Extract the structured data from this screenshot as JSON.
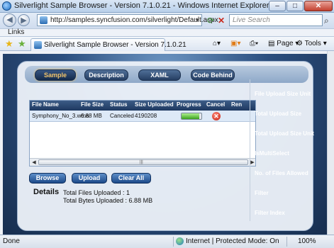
{
  "window": {
    "title": "Silverlight Sample Browser - Version 7.1.0.21 - Windows Internet Explorer",
    "minimize": "–",
    "maximize": "□",
    "close": "✕"
  },
  "address": {
    "url": "http://samples.syncfusion.com/silverlight/Default.aspx",
    "search_placeholder": "Live Search"
  },
  "links": {
    "label": "Links"
  },
  "tab": {
    "label": "Silverlight Sample Browser - Version 7.1.0.21"
  },
  "commands": {
    "page": "Page",
    "tools": "Tools"
  },
  "sample_tabs": [
    {
      "label": "Sample",
      "active": true
    },
    {
      "label": "Description",
      "active": false
    },
    {
      "label": "XAML",
      "active": false
    },
    {
      "label": "Code Behind",
      "active": false
    }
  ],
  "grid": {
    "columns": [
      "File Name",
      "File Size",
      "Status",
      "Size Uploaded",
      "Progress",
      "Cancel",
      "Ren"
    ],
    "rows": [
      {
        "file_name": "Symphony_No_3.wma",
        "file_size": "6.88 MB",
        "status": "Canceled",
        "size_uploaded": "4190208",
        "progress": 0.9
      }
    ]
  },
  "buttons": {
    "browse": "Browse",
    "upload": "Upload",
    "clear_all": "Clear All"
  },
  "details": {
    "title": "Details",
    "total_files": "Total Files Uploaded  : 1",
    "total_bytes": "Total Bytes Uploaded : 6.88 MB"
  },
  "properties": [
    "File Upload Size Unit",
    "Total Upload Size",
    "Total Upload Size Unit",
    "IsMultiSelect",
    "No. of Files Allowed",
    "Filter",
    "Filter Index"
  ],
  "status": {
    "text": "Done",
    "zone": "Internet | Protected Mode: On",
    "zoom": "100%"
  },
  "icons": {
    "back": "back-arrow-icon",
    "forward": "forward-arrow-icon",
    "refresh": "refresh-icon",
    "stop": "stop-icon",
    "search": "search-icon",
    "cancel": "cancel-x-icon"
  }
}
